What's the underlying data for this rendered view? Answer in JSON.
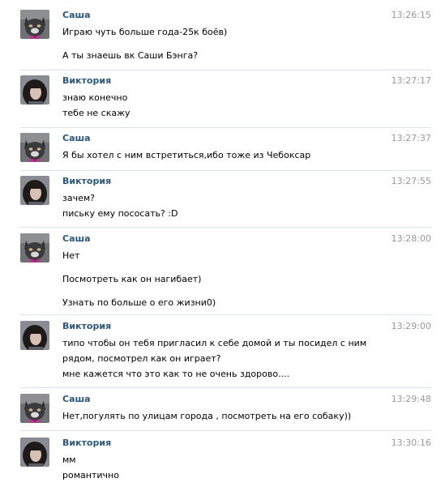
{
  "messages": [
    {
      "author": "Саша",
      "time": "13:26:15",
      "lines": [
        "Играю чуть больше года-25к боёв)",
        "А ты знаешь вк Саши Бэнга?"
      ]
    },
    {
      "author": "Виктория",
      "time": "13:27:17",
      "lines": [
        "знаю конечно",
        "тебе не скажу"
      ]
    },
    {
      "author": "Саша",
      "time": "13:27:37",
      "lines": [
        "Я бы хотел с ним встретиться,ибо тоже из Чебоксар"
      ]
    },
    {
      "author": "Виктория",
      "time": "13:27:55",
      "lines": [
        "зачем?",
        "письку ему пососать? :D"
      ]
    },
    {
      "author": "Саша",
      "time": "13:28:00",
      "lines": [
        "Нет",
        "Посмотреть как он нагибает)",
        "Узнать по больше о его жизни0)"
      ]
    },
    {
      "author": "Виктория",
      "time": "13:29:00",
      "lines": [
        "типо чтобы он тебя пригласил к себе домой и ты посидел с ним",
        "рядом, посмотрел как он играет?",
        "мне кажется что это как то не очень здорово...."
      ]
    },
    {
      "author": "Саша",
      "time": "13:29:48",
      "lines": [
        "Нет,погулять по улицам города , посмотреть на его собаку))"
      ]
    },
    {
      "author": "Виктория",
      "time": "13:30:16",
      "lines": [
        "мм",
        "романтично"
      ]
    }
  ]
}
